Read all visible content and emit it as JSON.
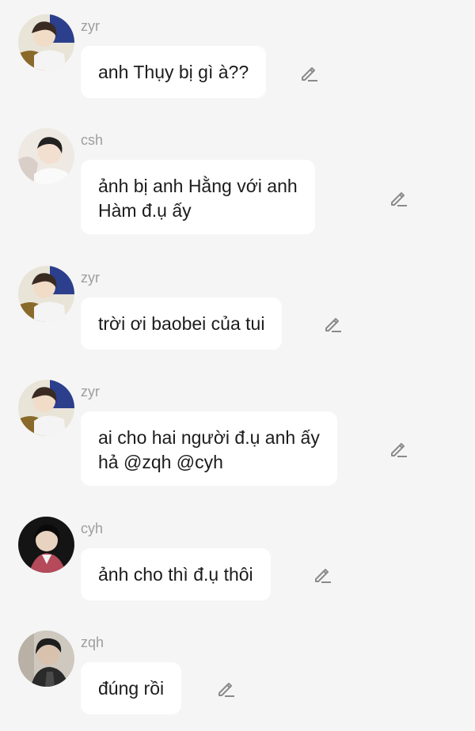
{
  "messages": [
    {
      "username": "zyr",
      "text": "anh Thụy bị gì à??",
      "avatar": "zyr-avatar",
      "edit_icon": "pencil-icon"
    },
    {
      "username": "csh",
      "text": "ảnh bị anh Hằng với anh\nHàm đ.ụ ấy",
      "avatar": "csh-avatar",
      "edit_icon": "pencil-icon"
    },
    {
      "username": "zyr",
      "text": "trời ơi baobei của tui",
      "avatar": "zyr-avatar",
      "edit_icon": "pencil-icon"
    },
    {
      "username": "zyr",
      "text": "ai cho hai người đ.ụ anh ấy\nhả @zqh @cyh",
      "avatar": "zyr-avatar",
      "edit_icon": "pencil-icon"
    },
    {
      "username": "cyh",
      "text": "ảnh cho thì đ.ụ thôi",
      "avatar": "cyh-avatar",
      "edit_icon": "pencil-icon"
    },
    {
      "username": "zqh",
      "text": "đúng rồi",
      "avatar": "zqh-avatar",
      "edit_icon": "pencil-icon"
    }
  ],
  "colors": {
    "background": "#f5f5f5",
    "bubble": "#ffffff",
    "username": "#9e9e9e",
    "text": "#1c1c1c",
    "icon": "#8a8a8a"
  }
}
